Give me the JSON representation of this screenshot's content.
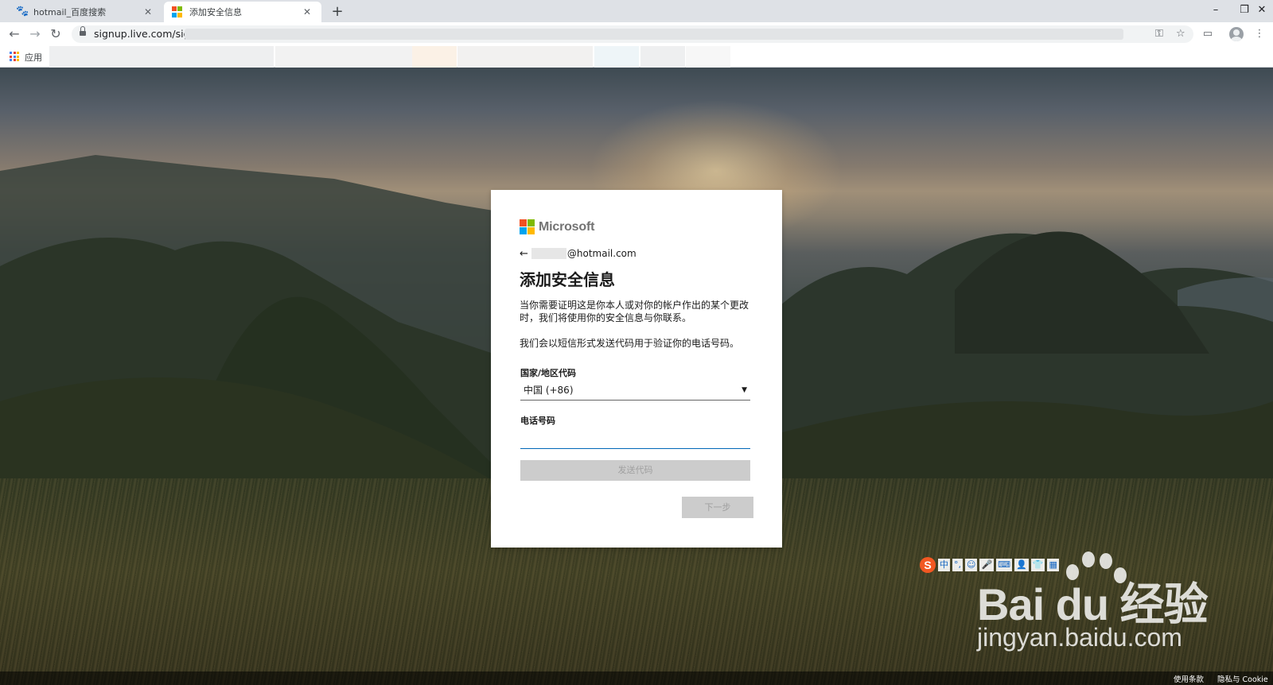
{
  "browser": {
    "tabs": [
      {
        "title": "hotmail_百度搜索",
        "favicon": "baidu-paw-icon",
        "active": false
      },
      {
        "title": "添加安全信息",
        "favicon": "microsoft-icon",
        "active": true
      }
    ],
    "url": "signup.live.com/sign",
    "bookmarks_bar": {
      "apps_label": "应用"
    }
  },
  "card": {
    "brand": "Microsoft",
    "identity_suffix": "@hotmail.com",
    "title": "添加安全信息",
    "description": "当你需要证明这是你本人或对你的帐户作出的某个更改时，我们将使用你的安全信息与你联系。",
    "sms_note": "我们会以短信形式发送代码用于验证你的电话号码。",
    "country_label": "国家/地区代码",
    "country_value": "中国 (+86)",
    "phone_label": "电话号码",
    "phone_value": "",
    "send_code_button": "发送代码",
    "next_button": "下一步"
  },
  "footer": {
    "terms": "使用条款",
    "privacy": "隐私与 Cookie"
  },
  "watermark": {
    "brand": "Bai du 经验",
    "url": "jingyan.baidu.com"
  },
  "ime_toolbar": {
    "mode": "中"
  },
  "colors": {
    "ms_red": "#f25022",
    "ms_green": "#7fba00",
    "ms_blue": "#00a4ef",
    "ms_yellow": "#ffb900",
    "accent": "#0067b8"
  }
}
